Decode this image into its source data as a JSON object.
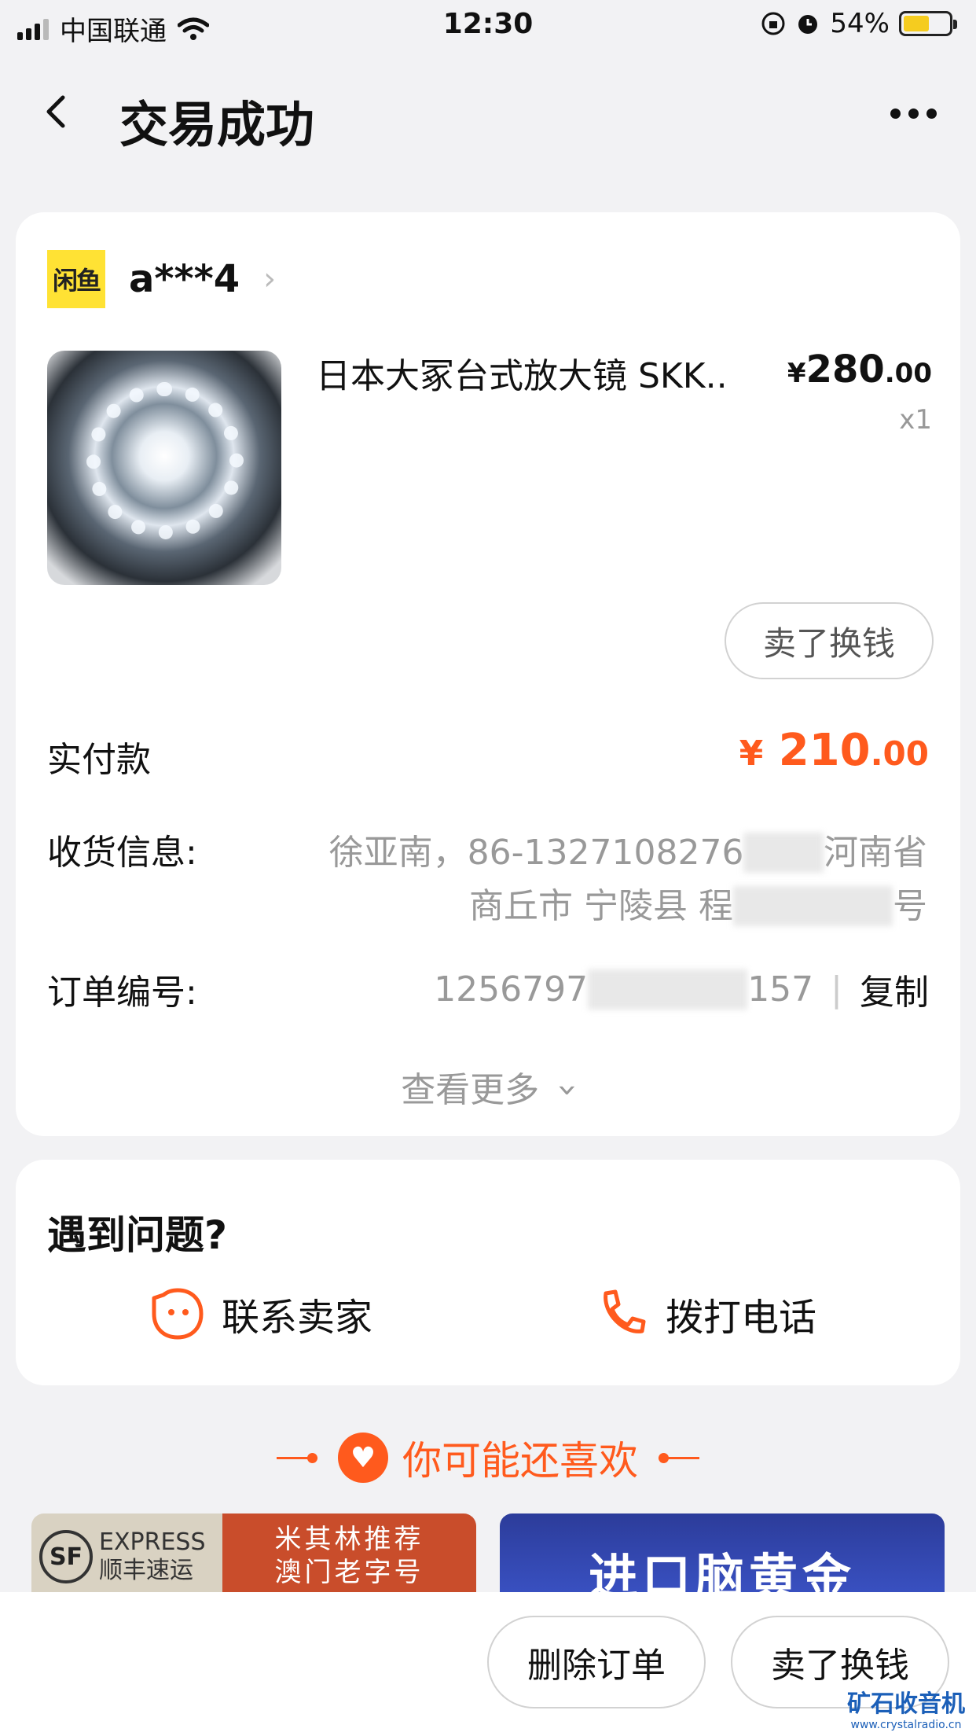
{
  "status_bar": {
    "carrier": "中国联通",
    "time": "12:30",
    "battery_percent": "54%"
  },
  "nav": {
    "title": "交易成功"
  },
  "order": {
    "shop_logo_text": "闲鱼",
    "seller_name": "a***4",
    "product_name": "日本大冢台式放大镜 SKK..",
    "price_symbol": "¥",
    "price_int": "280",
    "price_dec": ".00",
    "quantity": "x1",
    "sell_button": "卖了换钱",
    "paid_label": "实付款",
    "paid_symbol": "¥",
    "paid_int": "210",
    "paid_dec": ".00",
    "shipping_label": "收货信息:",
    "shipping_line1": "徐亚南，86-1327108276",
    "shipping_line1_tail": "河南省",
    "shipping_line2": "商丘市 宁陵县 程",
    "shipping_line2_tail": "号",
    "order_no_label": "订单编号:",
    "order_no_head": "1256797",
    "order_no_tail": "157",
    "copy_label": "复制",
    "view_more": "查看更多"
  },
  "help": {
    "title": "遇到问题?",
    "contact_seller": "联系卖家",
    "call_phone": "拨打电话"
  },
  "recommend": {
    "title": "你可能还喜欢",
    "banner1_brand": "EXPRESS",
    "banner1_brand_cn": "顺丰速运",
    "banner1_line1": "米其林推荐",
    "banner1_line2": "澳门老字号",
    "banner2_text": "进口脑黄金"
  },
  "bottom_bar": {
    "delete_order": "删除订单",
    "sell": "卖了换钱"
  },
  "watermark": {
    "text": "矿石收音机",
    "url": "www.crystalradio.cn"
  },
  "colors": {
    "accent": "#ff5a1d",
    "background": "#f2f2f4"
  }
}
